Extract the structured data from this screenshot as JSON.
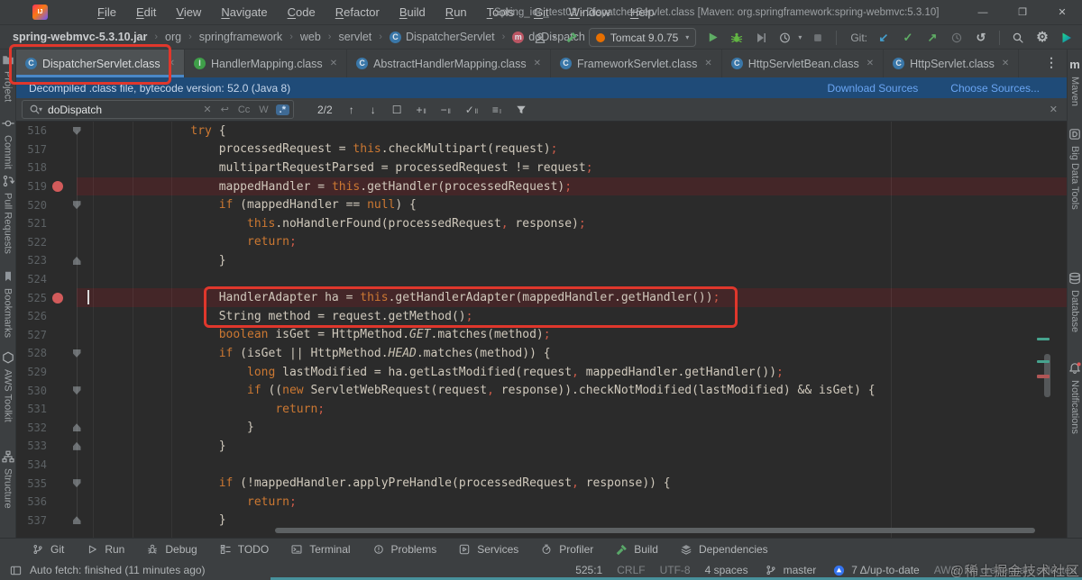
{
  "title_bar": {
    "menu_items": [
      "File",
      "Edit",
      "View",
      "Navigate",
      "Code",
      "Refactor",
      "Build",
      "Run",
      "Tools",
      "Git",
      "Window",
      "Help"
    ],
    "title": "Spring_ioc_test02 - DispatcherServlet.class [Maven: org.springframework:spring-webmvc:5.3.10]"
  },
  "breadcrumb_bar": {
    "items": [
      {
        "label": "spring-webmvc-5.3.10.jar",
        "bold": true
      },
      {
        "label": "org"
      },
      {
        "label": "springframework"
      },
      {
        "label": "web"
      },
      {
        "label": "servlet"
      },
      {
        "label": "DispatcherServlet",
        "icon": "class"
      },
      {
        "label": "doDispatch",
        "icon": "method"
      }
    ]
  },
  "toolbar": {
    "run_config_label": "Tomcat 9.0.75",
    "git_label": "Git:",
    "icons": [
      "user-profile",
      "build-hammer",
      "run",
      "debug",
      "run-with-coverage",
      "profiler",
      "stop",
      "git-update",
      "git-commit",
      "git-push",
      "git-history",
      "git-rollback",
      "search-everywhere",
      "settings-gear",
      "ide-logo"
    ]
  },
  "tab_bar": {
    "tabs": [
      {
        "label": "DispatcherServlet.class",
        "icon": "class",
        "active": true
      },
      {
        "label": "HandlerMapping.class",
        "icon": "interface"
      },
      {
        "label": "AbstractHandlerMapping.class",
        "icon": "class"
      },
      {
        "label": "FrameworkServlet.class",
        "icon": "class"
      },
      {
        "label": "HttpServletBean.class",
        "icon": "class"
      },
      {
        "label": "HttpServlet.class",
        "icon": "class"
      }
    ]
  },
  "banner": {
    "message": "Decompiled .class file, bytecode version: 52.0 (Java 8)",
    "links": [
      "Download Sources",
      "Choose Sources..."
    ]
  },
  "find_bar": {
    "query": "doDispatch",
    "toggles": {
      "match_case": "Cc",
      "words": "W",
      "regex": ".*"
    },
    "results_count": "2/2"
  },
  "editor": {
    "lines": [
      {
        "n": 516,
        "ind": 0,
        "fold": "open",
        "seg": [
          [
            "k",
            "try"
          ],
          [
            "p",
            " {"
          ]
        ]
      },
      {
        "n": 517,
        "ind": 1,
        "seg": [
          [
            "p",
            "processedRequest = "
          ],
          [
            "k",
            "this"
          ],
          [
            "p",
            ".checkMultipart(request)"
          ],
          [
            "s",
            ";"
          ]
        ]
      },
      {
        "n": 518,
        "ind": 1,
        "seg": [
          [
            "p",
            "multipartRequestParsed = processedRequest != request"
          ],
          [
            "s",
            ";"
          ]
        ]
      },
      {
        "n": 519,
        "ind": 1,
        "bp": true,
        "band": true,
        "seg": [
          [
            "p",
            "mappedHandler = "
          ],
          [
            "k",
            "this"
          ],
          [
            "p",
            ".getHandler(processedRequest)"
          ],
          [
            "s",
            ";"
          ]
        ]
      },
      {
        "n": 520,
        "ind": 1,
        "fold": "open",
        "seg": [
          [
            "k",
            "if"
          ],
          [
            "p",
            " (mappedHandler == "
          ],
          [
            "k",
            "null"
          ],
          [
            "p",
            ") {"
          ]
        ]
      },
      {
        "n": 521,
        "ind": 2,
        "seg": [
          [
            "k",
            "this"
          ],
          [
            "p",
            ".noHandlerFound(processedRequest"
          ],
          [
            "s",
            ","
          ],
          [
            "p",
            " response)"
          ],
          [
            "s",
            ";"
          ]
        ]
      },
      {
        "n": 522,
        "ind": 2,
        "seg": [
          [
            "k",
            "return"
          ],
          [
            "s",
            ";"
          ]
        ]
      },
      {
        "n": 523,
        "ind": 1,
        "fold": "close",
        "seg": [
          [
            "p",
            "}"
          ]
        ]
      },
      {
        "n": 524,
        "ind": 0,
        "seg": []
      },
      {
        "n": 525,
        "ind": 1,
        "bp": true,
        "band": true,
        "caret": true,
        "seg": [
          [
            "p",
            "HandlerAdapter ha = "
          ],
          [
            "k",
            "this"
          ],
          [
            "p",
            ".getHandlerAdapter(mappedHandler.getHandler())"
          ],
          [
            "s",
            ";"
          ]
        ]
      },
      {
        "n": 526,
        "ind": 1,
        "seg": [
          [
            "p",
            "String method = request.getMethod()"
          ],
          [
            "s",
            ";"
          ]
        ]
      },
      {
        "n": 527,
        "ind": 1,
        "seg": [
          [
            "k",
            "boolean"
          ],
          [
            "p",
            " isGet = HttpMethod."
          ],
          [
            "it",
            "GET"
          ],
          [
            "p",
            ".matches(method)"
          ],
          [
            "s",
            ";"
          ]
        ]
      },
      {
        "n": 528,
        "ind": 1,
        "fold": "open",
        "seg": [
          [
            "k",
            "if"
          ],
          [
            "p",
            " (isGet || HttpMethod."
          ],
          [
            "it",
            "HEAD"
          ],
          [
            "p",
            ".matches(method)) {"
          ]
        ]
      },
      {
        "n": 529,
        "ind": 2,
        "seg": [
          [
            "k",
            "long"
          ],
          [
            "p",
            " lastModified = ha.getLastModified(request"
          ],
          [
            "s",
            ","
          ],
          [
            "p",
            " mappedHandler.getHandler())"
          ],
          [
            "s",
            ";"
          ]
        ]
      },
      {
        "n": 530,
        "ind": 2,
        "fold": "open",
        "seg": [
          [
            "k",
            "if"
          ],
          [
            "p",
            " (("
          ],
          [
            "k",
            "new"
          ],
          [
            "p",
            " ServletWebRequest(request"
          ],
          [
            "s",
            ","
          ],
          [
            "p",
            " response)).checkNotModified(lastModified) && isGet) {"
          ]
        ]
      },
      {
        "n": 531,
        "ind": 3,
        "seg": [
          [
            "k",
            "return"
          ],
          [
            "s",
            ";"
          ]
        ]
      },
      {
        "n": 532,
        "ind": 2,
        "fold": "close",
        "seg": [
          [
            "p",
            "}"
          ]
        ]
      },
      {
        "n": 533,
        "ind": 1,
        "fold": "close",
        "seg": [
          [
            "p",
            "}"
          ]
        ]
      },
      {
        "n": 534,
        "ind": 0,
        "seg": []
      },
      {
        "n": 535,
        "ind": 1,
        "fold": "open",
        "seg": [
          [
            "k",
            "if"
          ],
          [
            "p",
            " (!mappedHandler.applyPreHandle(processedRequest"
          ],
          [
            "s",
            ","
          ],
          [
            "p",
            " response)) {"
          ]
        ]
      },
      {
        "n": 536,
        "ind": 2,
        "seg": [
          [
            "k",
            "return"
          ],
          [
            "s",
            ";"
          ]
        ]
      },
      {
        "n": 537,
        "ind": 1,
        "fold": "close",
        "seg": [
          [
            "p",
            "}"
          ]
        ]
      }
    ]
  },
  "left_stripe": {
    "items": [
      {
        "label": "Project",
        "icon": "project-folder"
      },
      {
        "label": "Commit",
        "icon": "commit-node"
      },
      {
        "label": "Pull Requests",
        "icon": "pull-request"
      },
      {
        "label": "Bookmarks",
        "icon": "bookmark-flag"
      },
      {
        "label": "AWS Toolkit",
        "icon": "aws-hexagon"
      },
      {
        "label": "Structure",
        "icon": "structure-tree"
      }
    ]
  },
  "right_stripe": {
    "items": [
      {
        "label": "Maven",
        "icon": "maven-m"
      },
      {
        "label": "Big Data Tools",
        "icon": "big-data"
      },
      {
        "label": "Database",
        "icon": "database-cylinder"
      },
      {
        "label": "Notifications",
        "icon": "bell-badge"
      }
    ]
  },
  "tool_window_bar": {
    "items": [
      {
        "label": "Git",
        "icon": "git-branch"
      },
      {
        "label": "Run",
        "icon": "run-triangle"
      },
      {
        "label": "Debug",
        "icon": "debug-bug"
      },
      {
        "label": "TODO",
        "icon": "todo-list"
      },
      {
        "label": "Terminal",
        "icon": "terminal-prompt"
      },
      {
        "label": "Problems",
        "icon": "problems-circle"
      },
      {
        "label": "Services",
        "icon": "services-box"
      },
      {
        "label": "Profiler",
        "icon": "profiler-clock"
      },
      {
        "label": "Build",
        "icon": "build-hammer"
      },
      {
        "label": "Dependencies",
        "icon": "dependencies-stack"
      }
    ]
  },
  "status_bar": {
    "left_message": "Auto fetch: finished (11 minutes ago)",
    "position": "525:1",
    "line_ending": "CRLF",
    "encoding": "UTF-8",
    "indent": "4 spaces",
    "branch": "master",
    "vcs_status": "7 Δ/up-to-date",
    "aws_status": "AWS: No credentials selected"
  },
  "watermark": "@稀土掘金技术社区"
}
